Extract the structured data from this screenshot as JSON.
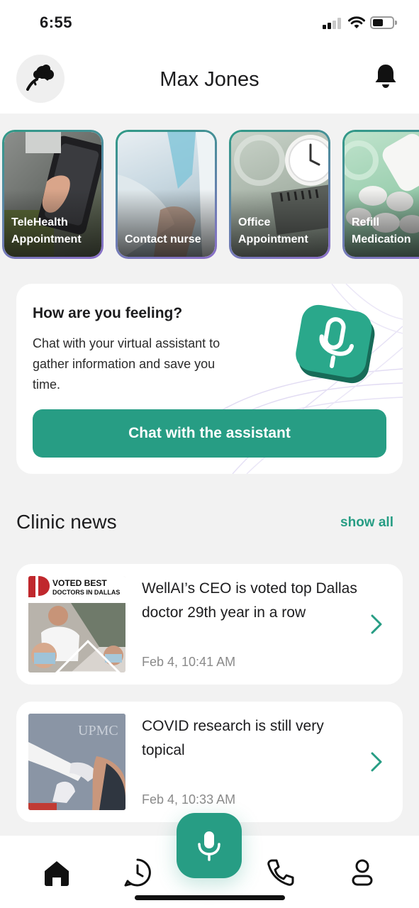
{
  "status_bar": {
    "time": "6:55"
  },
  "header": {
    "user_name": "Max Jones"
  },
  "quick_actions": [
    {
      "line1": "TeleHealth",
      "line2": "Appointment"
    },
    {
      "line1": "",
      "line2": "Contact nurse"
    },
    {
      "line1": "Office",
      "line2": "Appointment"
    },
    {
      "line1": "Refill",
      "line2": "Medication"
    }
  ],
  "assistant": {
    "title": "How are you feeling?",
    "description": "Chat with your virtual assistant to gather information and save you time.",
    "button_label": "Chat with the assistant"
  },
  "news": {
    "section_title": "Clinic news",
    "show_all": "show all",
    "items": [
      {
        "headline": "WellAI’s CEO is voted top Dallas doctor 29th year in a row",
        "date": "Feb 4, 10:41 AM",
        "image_caption": "VOTED BEST DOCTORS IN DALLAS"
      },
      {
        "headline": "COVID research is still very topical",
        "date": "Feb 4, 10:33 AM",
        "image_caption": "UPMC"
      }
    ]
  },
  "colors": {
    "accent": "#279d84",
    "accent_border_start": "#2f9a86",
    "accent_border_end": "#8b6fc9",
    "background": "#f2f2f2"
  },
  "icons": {
    "tabs": [
      "home-icon",
      "history-icon",
      "microphone-icon",
      "phone-icon",
      "profile-icon"
    ]
  }
}
